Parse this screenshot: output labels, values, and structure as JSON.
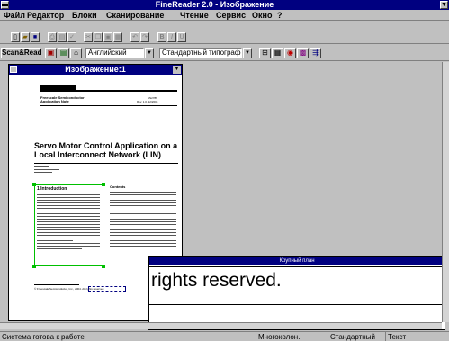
{
  "window": {
    "title": "FineReader 2.0 - Изображение",
    "sysmenu_glyph": "▬",
    "max_glyph": "▼"
  },
  "menu": [
    "Файл",
    "Редактор",
    "Блоки",
    "Сканирование",
    "Чтение",
    "Сервис",
    "Окно",
    "?"
  ],
  "toolbar1": {
    "bold": "B",
    "italic": "I",
    "underline": "U"
  },
  "toolbar2": {
    "scan_read": "Scan&Read",
    "language": "Английский",
    "font_type": "Стандартный типографский"
  },
  "image_window": {
    "title": "Изображение:1",
    "doc": {
      "brand_line1": "Freescale Semiconductor",
      "brand_line2": "Application Note",
      "doc_no": "AN2786",
      "doc_rev": "Rev. 1.0, 12/2004",
      "heading": "Servo Motor Control Application on a Local Interconnect Network (LIN)",
      "intro_title": "1  Introduction",
      "contents_title": "Contents",
      "footer": "© Freescale Semiconductor, Inc., 2004. All rights reserved."
    }
  },
  "zoom_window": {
    "title": "Крупный план",
    "text": "rights reserved."
  },
  "status": {
    "message": "Система готова к работе",
    "columns": "Многоколон.",
    "standard": "Стандартный",
    "mode": "Текст"
  }
}
